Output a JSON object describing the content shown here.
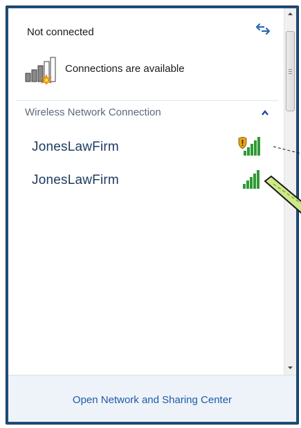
{
  "header": {
    "status": "Not connected",
    "available_text": "Connections are available"
  },
  "section": {
    "title": "Wireless Network Connection"
  },
  "networks": [
    {
      "name": "JonesLawFirm",
      "secured": false
    },
    {
      "name": "JonesLawFirm",
      "secured": true
    }
  ],
  "footer": {
    "link_label": "Open Network and Sharing Center"
  },
  "icons": {
    "refresh": "refresh-icon",
    "available": "signal-bars-starburst-icon",
    "collapse": "chevron-up-icon",
    "signal": "signal-strength-icon",
    "signal_warning": "signal-strength-shield-warning-icon"
  },
  "colors": {
    "frame": "#1f4f7a",
    "link": "#1e5aa8",
    "network_text": "#1b3a5e",
    "signal_green": "#2e9a35",
    "footer_bg": "#eef3f9"
  }
}
